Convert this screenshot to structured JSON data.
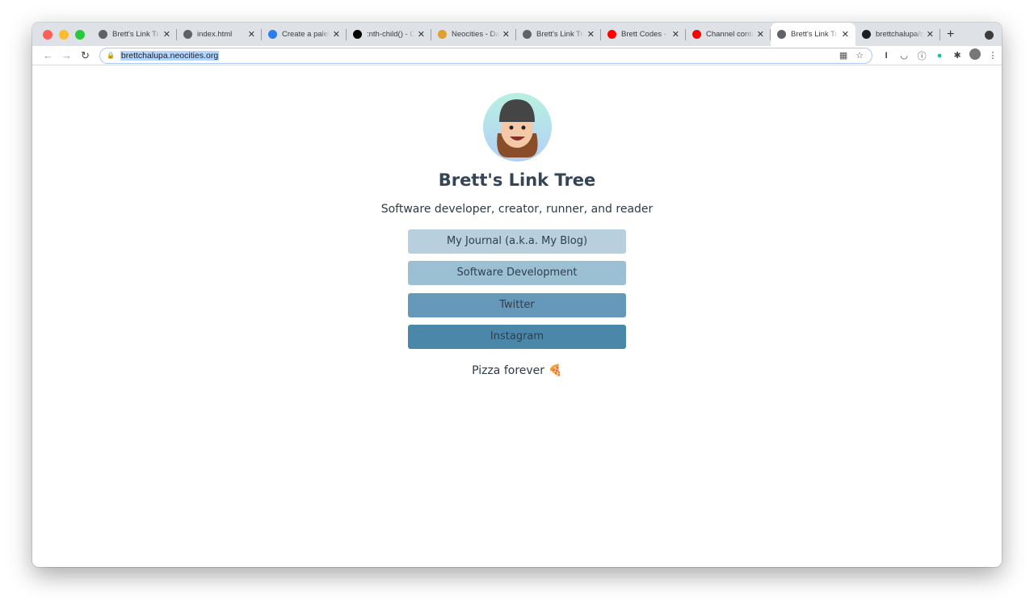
{
  "browser": {
    "tabs": [
      {
        "title": "Brett's Link Tre",
        "icon": "globe-icon",
        "color": "#5f6368"
      },
      {
        "title": "index.html",
        "icon": "globe-icon",
        "color": "#5f6368"
      },
      {
        "title": "Create a palett",
        "icon": "coolors-icon",
        "color": "#2b7de9"
      },
      {
        "title": ":nth-child() - C",
        "icon": "css-tricks-icon",
        "color": "#000000"
      },
      {
        "title": "Neocities - Da",
        "icon": "neocities-cat-icon",
        "color": "#e0a030"
      },
      {
        "title": "Brett's Link Tre",
        "icon": "globe-icon",
        "color": "#5f6368"
      },
      {
        "title": "Brett Codes - Y",
        "icon": "youtube-icon",
        "color": "#ff0000"
      },
      {
        "title": "Channel conte",
        "icon": "youtube-icon",
        "color": "#ff0000"
      },
      {
        "title": "Brett's Link Tre",
        "icon": "globe-icon",
        "color": "#5f6368",
        "active": true
      },
      {
        "title": "brettchalupa/s",
        "icon": "github-icon",
        "color": "#1b1f23"
      }
    ],
    "url": "brettchalupa.neocities.org"
  },
  "page": {
    "title": "Brett's Link Tree",
    "subtitle": "Software developer, creator, runner, and reader",
    "links": [
      {
        "label": "My Journal (a.k.a. My Blog)",
        "color": "#b8d0de"
      },
      {
        "label": "Software Development",
        "color": "#9bc0d3"
      },
      {
        "label": "Twitter",
        "color": "#6699b9"
      },
      {
        "label": "Instagram",
        "color": "#4b87a8"
      }
    ],
    "footer": "Pizza forever 🍕"
  }
}
